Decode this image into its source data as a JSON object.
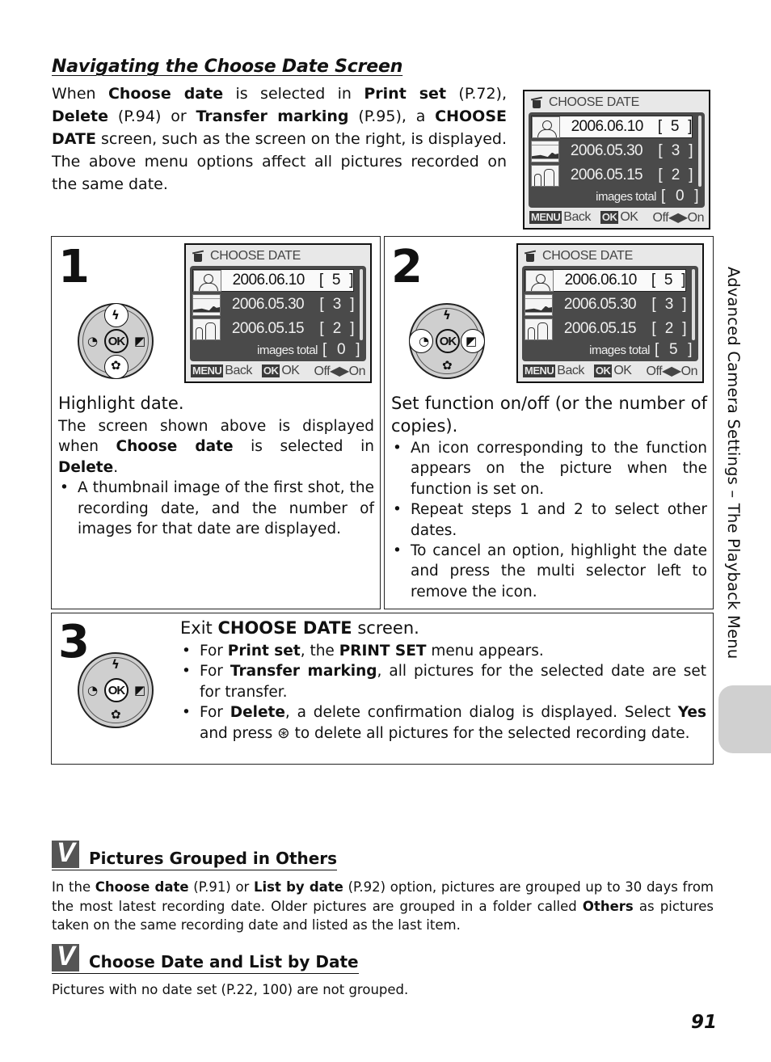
{
  "heading": "Navigating the Choose Date Screen",
  "intro": {
    "parts": [
      "When ",
      "Choose date",
      " is selected in ",
      "Print set",
      " (P.72), ",
      "Delete",
      " (P.94) or ",
      "Transfer marking",
      " (P.95), a ",
      "CHOOSE DATE",
      " screen, such as the screen on the right, is displayed. The above menu options affect all pictures recorded on the same date."
    ]
  },
  "lcd_screens": [
    {
      "title": "CHOOSE DATE",
      "rows": [
        {
          "date": "2006.06.10",
          "count": "5",
          "thumb": "portrait",
          "selected": true
        },
        {
          "date": "2006.05.30",
          "count": "3",
          "thumb": "landscape",
          "selected": false
        },
        {
          "date": "2006.05.15",
          "count": "2",
          "thumb": "people",
          "selected": false
        }
      ],
      "total_label": "images total",
      "total_value": "0",
      "footer": {
        "menu_key": "MENU",
        "back": "Back",
        "ok_key": "OK",
        "ok": "OK",
        "off_on": "Off◀▶On"
      }
    },
    {
      "title": "CHOOSE DATE",
      "rows": [
        {
          "date": "2006.06.10",
          "count": "5",
          "thumb": "portrait",
          "selected": true
        },
        {
          "date": "2006.05.30",
          "count": "3",
          "thumb": "landscape",
          "selected": false
        },
        {
          "date": "2006.05.15",
          "count": "2",
          "thumb": "people",
          "selected": false
        }
      ],
      "total_label": "images total",
      "total_value": "0",
      "footer": {
        "menu_key": "MENU",
        "back": "Back",
        "ok_key": "OK",
        "ok": "OK",
        "off_on": "Off◀▶On"
      }
    },
    {
      "title": "CHOOSE DATE",
      "rows": [
        {
          "date": "2006.06.10",
          "count": "5",
          "thumb": "portrait",
          "selected": true
        },
        {
          "date": "2006.05.30",
          "count": "3",
          "thumb": "landscape",
          "selected": false
        },
        {
          "date": "2006.05.15",
          "count": "2",
          "thumb": "people",
          "selected": false
        }
      ],
      "total_label": "images total",
      "total_value": "5",
      "footer": {
        "menu_key": "MENU",
        "back": "Back",
        "ok_key": "OK",
        "ok": "OK",
        "off_on": "Off◀▶On"
      }
    }
  ],
  "dial": {
    "ok": "OK",
    "up": "flash-icon",
    "down": "macro-icon",
    "left": "self-timer-icon",
    "right": "exposure-comp-icon"
  },
  "steps": [
    {
      "number": "1",
      "head": "Highlight date.",
      "body_parts": [
        "The screen shown above is displayed when ",
        "Choose date",
        " is selected in ",
        "Delete",
        "."
      ],
      "bullets": [
        "A thumbnail image of the first shot, the recording date, and the number of images for that date are displayed."
      ]
    },
    {
      "number": "2",
      "head": "Set function on/off (or the number of copies).",
      "bullets": [
        "An icon corresponding to the function appears on the picture when the function is set on.",
        "Repeat steps 1 and 2 to select other dates.",
        "To cancel an option, highlight the date and press the multi selector left to remove the icon."
      ]
    },
    {
      "number": "3",
      "head_parts": [
        "Exit ",
        "CHOOSE DATE",
        " screen."
      ],
      "bullets": [
        {
          "parts": [
            "For ",
            "Print set",
            ", the ",
            "PRINT SET",
            " menu appears."
          ]
        },
        {
          "parts": [
            "For ",
            "Transfer marking",
            ", all pictures for the selected date are set for transfer."
          ]
        },
        {
          "parts": [
            "For ",
            "Delete",
            ", a delete confirmation dialog is displayed. Select ",
            "Yes",
            " and press ",
            "⊛",
            " to delete all pictures for the selected recording date."
          ]
        }
      ]
    }
  ],
  "notes": [
    {
      "title": "Pictures Grouped in Others",
      "parts": [
        "In the ",
        "Choose date",
        " (P.91) or ",
        "List by date",
        " (P.92) option, pictures are grouped up to 30 days from the most latest recording date. Older pictures are grouped in a folder called ",
        "Others",
        " as pictures taken on the same recording date and listed as the last item."
      ]
    },
    {
      "title": "Choose Date and List by Date",
      "parts": [
        "Pictures with no date set (P.22, 100) are not grouped."
      ]
    }
  ],
  "sidebar_label": "Advanced Camera Settings – The Playback Menu",
  "page_number": "91"
}
